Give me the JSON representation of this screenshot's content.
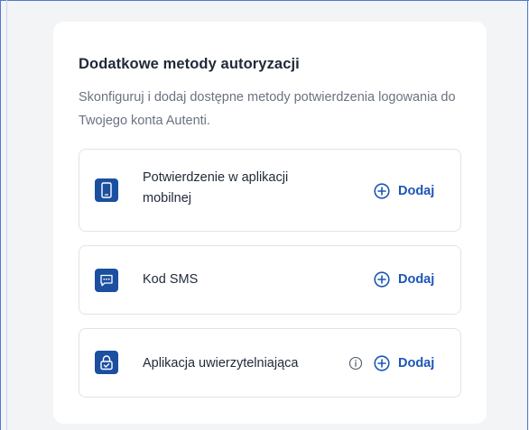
{
  "section": {
    "title": "Dodatkowe metody autoryzacji",
    "description": "Skonfiguruj i dodaj dostępne metody potwierdzenia logowania do Twojego konta Autenti."
  },
  "methods": [
    {
      "label": "Potwierdzenie w aplikacji mobilnej",
      "icon": "mobile-phone-icon",
      "action": "Dodaj"
    },
    {
      "label": "Kod SMS",
      "icon": "sms-message-icon",
      "action": "Dodaj"
    },
    {
      "label": "Aplikacja uwierzytelniająca",
      "icon": "lock-check-icon",
      "info_icon": "info-icon",
      "action": "Dodaj"
    }
  ],
  "colors": {
    "accent": "#1b56b8",
    "icon_bg": "#1b4fa0",
    "text": "#1f2937",
    "muted": "#6b7280"
  }
}
